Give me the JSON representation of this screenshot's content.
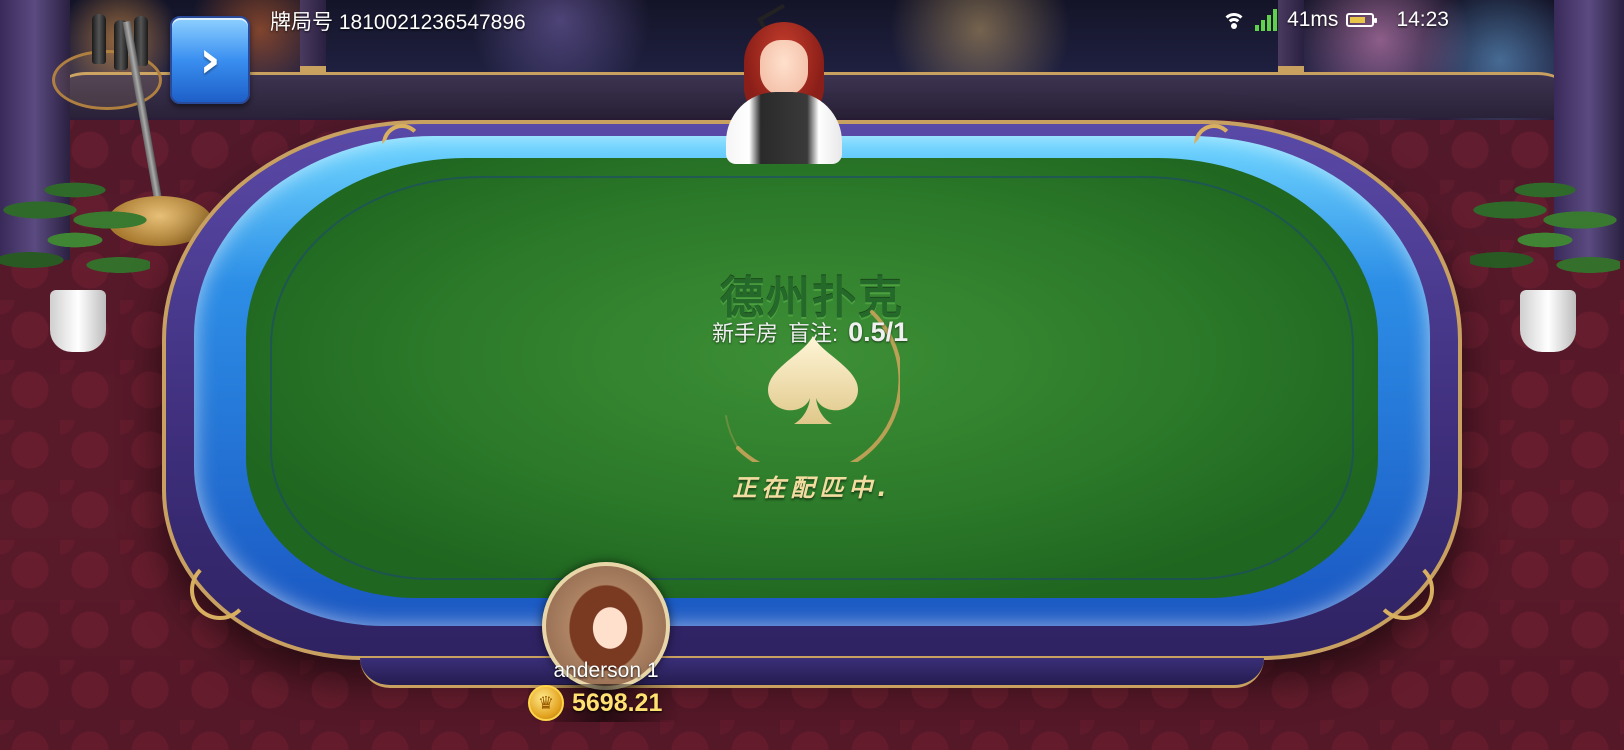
{
  "header": {
    "room_id_label": "牌局号",
    "room_id_value": "1810021236547896",
    "back_icon": "chevron-right-icon"
  },
  "status_bar": {
    "wifi_icon": "wifi-icon",
    "signal_icon": "signal-icon",
    "ping": "41ms",
    "battery_icon": "battery-icon",
    "time": "14:23"
  },
  "table": {
    "game_title": "德州扑克",
    "room_type": "新手房",
    "blind_label": "盲注:",
    "blind_value": "0.5/1",
    "matching_text": "正在配匹中.",
    "center_icon": "spade-icon"
  },
  "player": {
    "name": "anderson 1",
    "balance": "5698.21",
    "coin_icon": "coin-icon"
  },
  "colors": {
    "felt": "#2c7a2a",
    "rail_blue": "#2d8ee6",
    "rail_purple": "#40307e",
    "gold": "#c8a060",
    "balance_text": "#ffe070"
  }
}
